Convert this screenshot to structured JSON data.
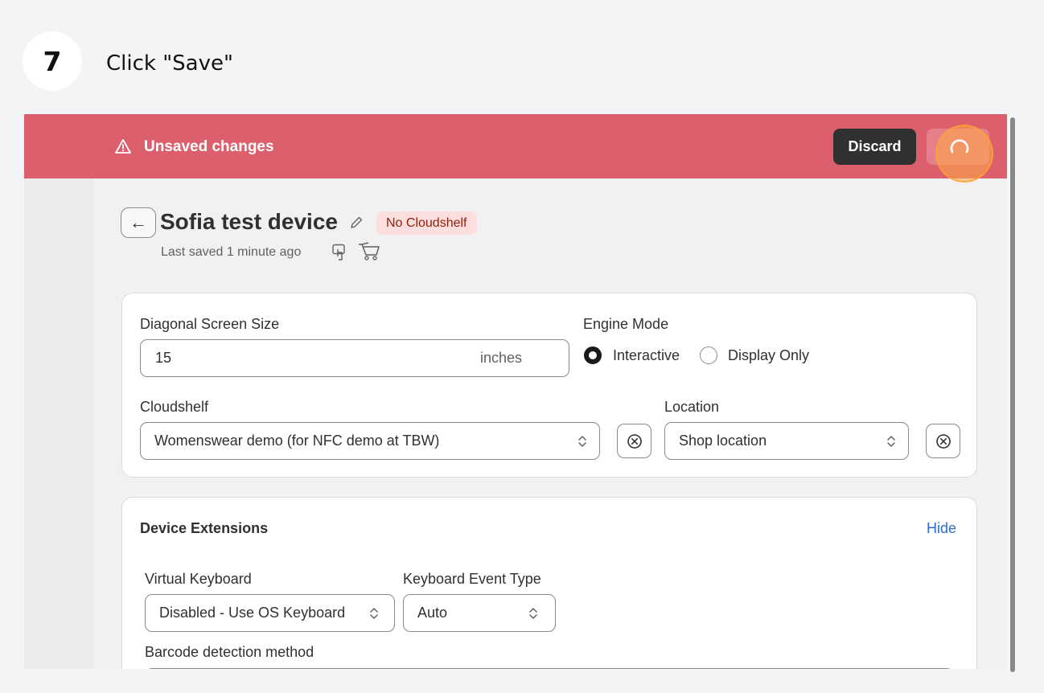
{
  "step": {
    "number": "7",
    "instruction": "Click \"Save\""
  },
  "unsaved_bar": {
    "message": "Unsaved changes",
    "discard_label": "Discard",
    "colors": {
      "bar": "#dc5f6d",
      "discard": "#303030",
      "save": "#e57f8a"
    }
  },
  "header": {
    "title": "Sofia test device",
    "badge": "No Cloudshelf",
    "last_saved": "Last saved 1 minute ago"
  },
  "settings_card": {
    "screen_size": {
      "label": "Diagonal Screen Size",
      "value": "15",
      "suffix": "inches"
    },
    "engine_mode": {
      "label": "Engine Mode",
      "options": [
        {
          "label": "Interactive",
          "selected": true
        },
        {
          "label": "Display Only",
          "selected": false
        }
      ]
    },
    "cloudshelf": {
      "label": "Cloudshelf",
      "value": "Womenswear demo (for NFC demo at TBW)"
    },
    "location": {
      "label": "Location",
      "value": "Shop location"
    }
  },
  "extensions_card": {
    "title": "Device Extensions",
    "hide_label": "Hide",
    "virtual_keyboard": {
      "label": "Virtual Keyboard",
      "value": "Disabled - Use OS Keyboard"
    },
    "keyboard_event_type": {
      "label": "Keyboard Event Type",
      "value": "Auto"
    },
    "barcode": {
      "label": "Barcode detection method"
    }
  }
}
